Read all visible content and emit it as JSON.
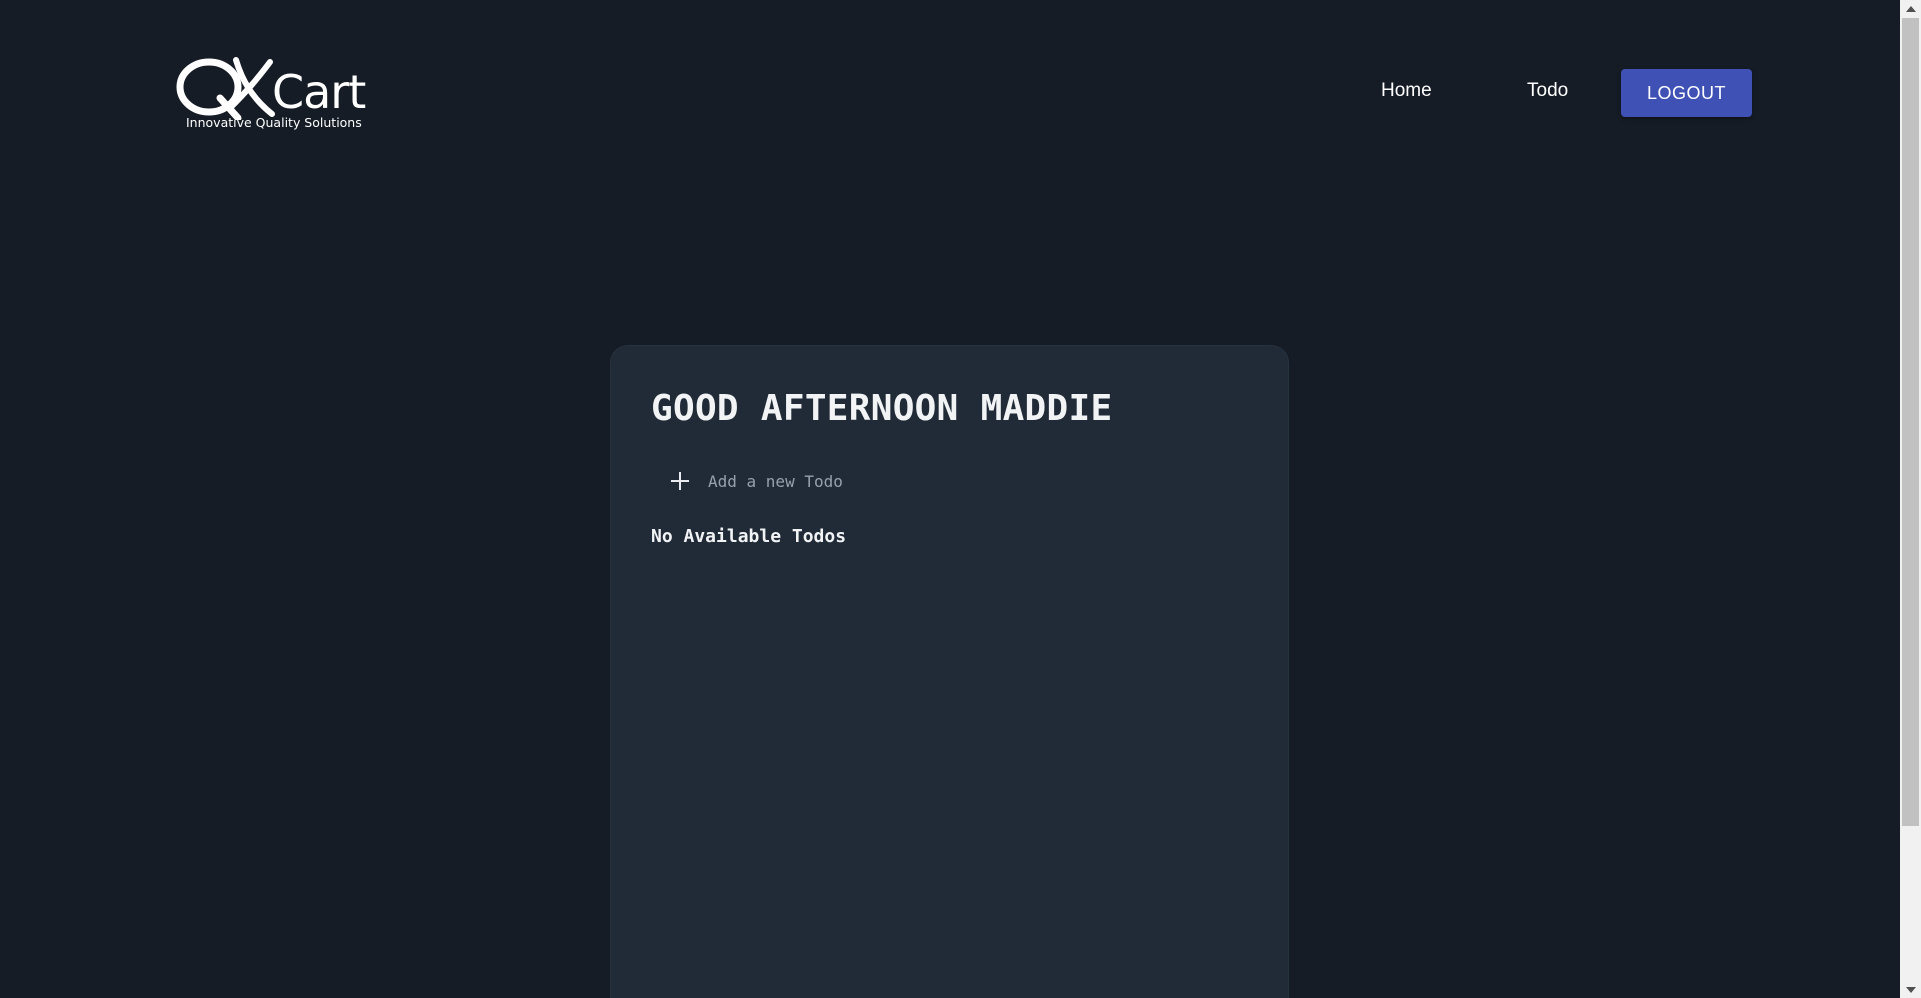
{
  "header": {
    "logo": {
      "word": "Cart",
      "tagline": "Innovative Quality Solutions",
      "mark_letters": "QK"
    },
    "nav": {
      "home_label": "Home",
      "todo_label": "Todo",
      "logout_label": "LOGOUT"
    }
  },
  "main": {
    "greeting": "GOOD AFTERNOON MADDIE",
    "add_todo": {
      "placeholder": "Add a new Todo",
      "value": "",
      "icon": "plus-icon"
    },
    "empty_message": "No Available Todos"
  },
  "colors": {
    "background": "#161c25",
    "card": "#212b37",
    "accent": "#3f51b5",
    "text": "#f1f3f5",
    "placeholder": "#97a1ad"
  }
}
